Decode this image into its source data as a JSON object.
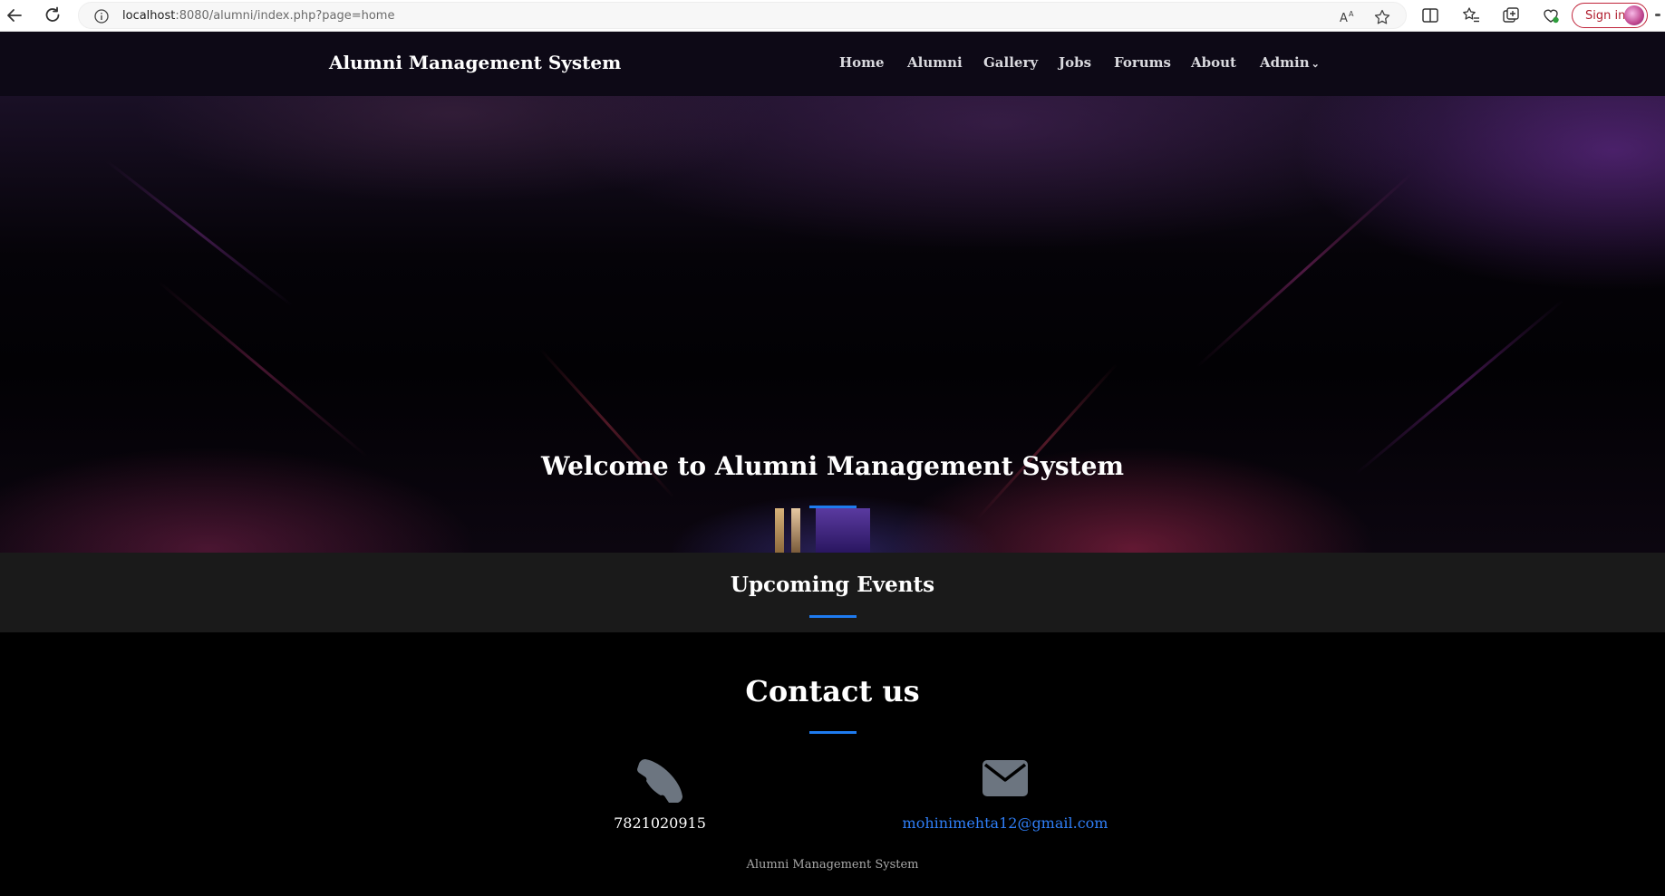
{
  "browser": {
    "url_host": "localhost",
    "url_path": ":8080/alumni/index.php?page=home",
    "signin_label": "Sign in"
  },
  "navbar": {
    "brand": "Alumni Management System",
    "links": [
      {
        "label": "Home"
      },
      {
        "label": "Alumni"
      },
      {
        "label": "Gallery"
      },
      {
        "label": "Jobs"
      },
      {
        "label": "Forums"
      },
      {
        "label": "About"
      },
      {
        "label": "Admin"
      }
    ]
  },
  "hero": {
    "title": "Welcome to Alumni Management System"
  },
  "events": {
    "title": "Upcoming Events"
  },
  "contact": {
    "title": "Contact us",
    "phone": "7821020915",
    "email": "mohinimehta12@gmail.com"
  },
  "footer": {
    "text": "Alumni Management System"
  },
  "colors": {
    "accent": "#1e7bf0",
    "link": "#2f7ef6",
    "icon": "#6c7580"
  }
}
